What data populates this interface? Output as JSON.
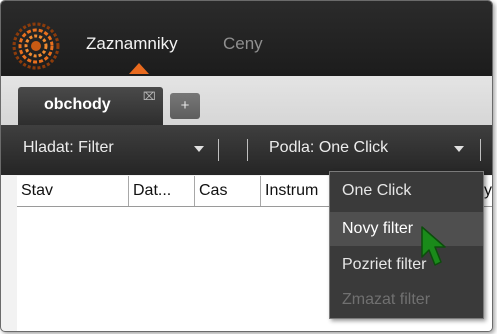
{
  "nav": {
    "items": [
      {
        "label": "Zaznamniky",
        "active": true
      },
      {
        "label": "Ceny",
        "active": false
      }
    ],
    "accent_color": "#e86a1e"
  },
  "tabs": {
    "items": [
      {
        "label": "obchody",
        "close_icon": "close-icon"
      }
    ],
    "add_label": "+"
  },
  "toolbar": {
    "search_label": "Hladat:",
    "search_value": "Filter",
    "sort_label": "Podla:",
    "sort_value": "One Click"
  },
  "table": {
    "columns": [
      "Stav",
      "Dat...",
      "Cas",
      "Instrum",
      "yp"
    ]
  },
  "dropdown_menu": {
    "items": [
      {
        "label": "One Click",
        "state": "normal"
      },
      {
        "label": "Novy filter",
        "state": "hover"
      },
      {
        "label": "Pozriet filter",
        "state": "normal"
      },
      {
        "label": "Zmazat filter",
        "state": "disabled"
      }
    ]
  },
  "cursor": {
    "icon": "pointer-arrow-icon",
    "color": "#1a8a1a"
  }
}
